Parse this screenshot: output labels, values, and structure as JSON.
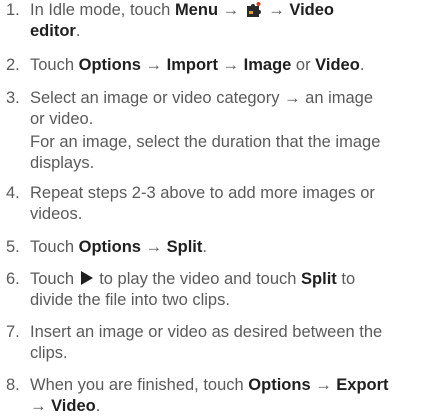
{
  "steps": [
    {
      "num": "1.",
      "a": "In Idle mode, touch ",
      "k1": "Menu",
      "arrow1": " → ",
      "icon": "applications-puzzle-icon",
      "arrow2": " → ",
      "k2a": "Video",
      "k2b": "editor",
      "end": "."
    },
    {
      "num": "2.",
      "a": "Touch ",
      "k1": "Options",
      "b": " → ",
      "k2": "Import",
      "c": " → ",
      "k3": "Image",
      "d": " or ",
      "k4": "Video",
      "e": "."
    },
    {
      "num": "3.",
      "l1": "Select an image or video category → an image",
      "l2": "or video.",
      "s1": "For an image, select the duration that the image",
      "s2": "displays."
    },
    {
      "num": "4.",
      "l1": "Repeat steps 2-3 above to add more images or",
      "l2": "videos."
    },
    {
      "num": "5.",
      "a": "Touch ",
      "k1": "Options",
      "b": " → ",
      "k2": "Split",
      "c": "."
    },
    {
      "num": "6.",
      "a": "Touch ",
      "icon": "play-icon",
      "b": " to play the video and touch ",
      "k1": "Split",
      "c": " to",
      "l2": "divide the file into two clips."
    },
    {
      "num": "7.",
      "l1": "Insert an image or video as desired between the",
      "l2": "clips."
    },
    {
      "num": "8.",
      "a": "When you are finished, touch ",
      "k1": "Options",
      "b": " → ",
      "k2": "Export",
      "l2a": "→ ",
      "k3": "Video",
      "c": "."
    }
  ]
}
